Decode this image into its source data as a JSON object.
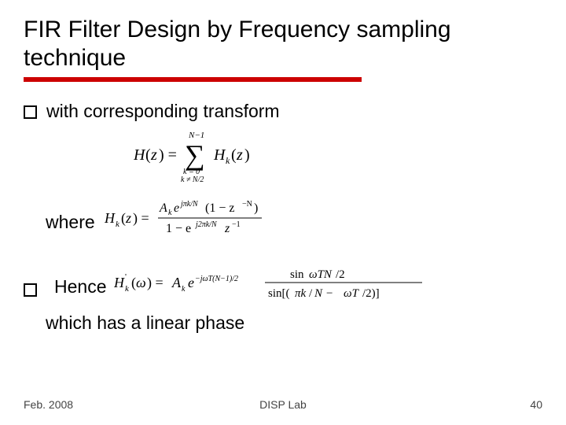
{
  "slide": {
    "title": "FIR Filter Design by Frequency sampling technique",
    "bullets": [
      {
        "lead": "with corresponding transform"
      },
      {
        "lead": "Hence"
      }
    ],
    "eq1": "H(z) = \\sum_{k=0, k\\ne N/2}^{N-1} H_k(z)",
    "where_label": "where",
    "eq2": "H_k(z) = A_k e^{j\\pi k/N} (1 - z^{-N}) / (1 - e^{j2\\pi k/N} z^{-1})",
    "eq3": "H'_k(\\omega) = A_k e^{-j\\omega T(N-1)/2} \\cdot sin(\\omega T N/2) / sin[(\\pi k/N - \\omega T/2)]",
    "conclusion": "which has a linear phase"
  },
  "footer": {
    "date": "Feb. 2008",
    "org": "DISP Lab",
    "page": "40"
  }
}
